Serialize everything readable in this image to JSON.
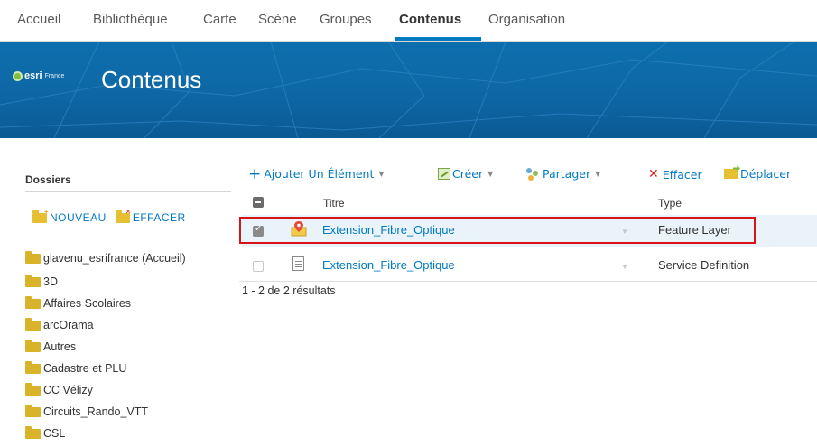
{
  "nav": {
    "tabs": [
      {
        "label": "Accueil",
        "active": false
      },
      {
        "label": "Bibliothèque",
        "active": false
      },
      {
        "label": "Carte",
        "active": false
      },
      {
        "label": "Scène",
        "active": false
      },
      {
        "label": "Groupes",
        "active": false
      },
      {
        "label": "Contenus",
        "active": true
      },
      {
        "label": "Organisation",
        "active": false
      }
    ]
  },
  "banner": {
    "logo_esri": "esri",
    "logo_france": "France",
    "title": "Contenus",
    "background_color": "#0e67a5"
  },
  "sidebar": {
    "heading": "Dossiers",
    "new_label": "NOUVEAU",
    "delete_label": "EFFACER",
    "folders": [
      {
        "label": "glavenu_esrifrance (Accueil)"
      },
      {
        "label": "3D"
      },
      {
        "label": "Affaires Scolaires"
      },
      {
        "label": "arcOrama"
      },
      {
        "label": "Autres"
      },
      {
        "label": "Cadastre et PLU"
      },
      {
        "label": "CC Vélizy"
      },
      {
        "label": "Circuits_Rando_VTT"
      },
      {
        "label": "CSL"
      }
    ]
  },
  "toolbar": {
    "add_label": "Ajouter Un Élément",
    "create_label": "Créer",
    "share_label": "Partager",
    "delete_label": "Effacer",
    "move_label": "Déplacer",
    "accent_color": "#0079c1"
  },
  "table": {
    "columns": {
      "title": "Titre",
      "type": "Type"
    },
    "rows": [
      {
        "title": "Extension_Fibre_Optique",
        "type": "Feature Layer",
        "checked": true,
        "icon": "feature-layer-icon"
      },
      {
        "title": "Extension_Fibre_Optique",
        "type": "Service Definition",
        "checked": false,
        "icon": "document-icon"
      }
    ],
    "results_label": "1 - 2 de 2 résultats",
    "highlight_color": "#d7141a"
  }
}
